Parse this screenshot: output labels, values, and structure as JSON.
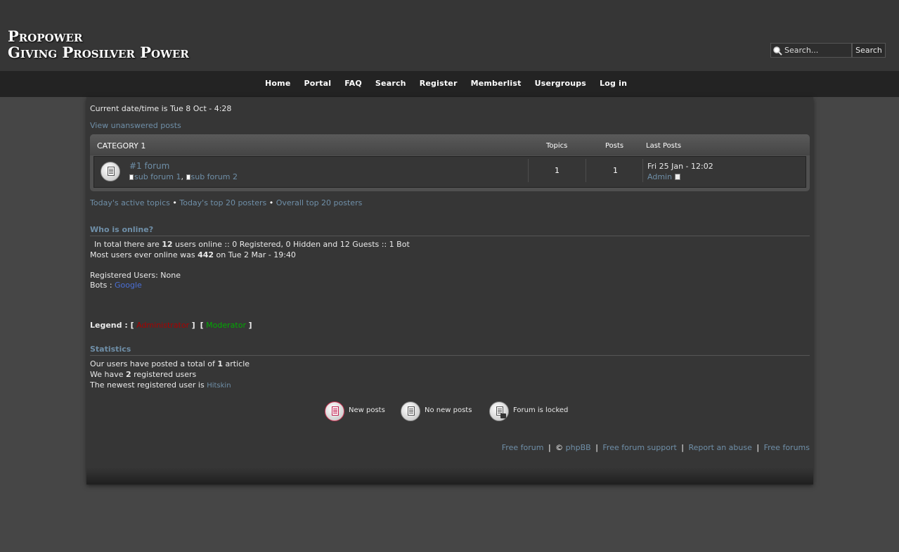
{
  "header": {
    "logo_line1": "Propower",
    "logo_line2": "Giving Prosilver Power",
    "search": {
      "placeholder": "Search...",
      "button": "Search"
    }
  },
  "nav": [
    "Home",
    "Portal",
    "FAQ",
    "Search",
    "Register",
    "Memberlist",
    "Usergroups",
    "Log in"
  ],
  "page": {
    "current_datetime": "Current date/time is Tue 8 Oct - 4:28",
    "unanswered_link": "View unanswered posts"
  },
  "category": {
    "title": "CATEGORY 1",
    "columns": {
      "topics": "Topics",
      "posts": "Posts",
      "last_posts": "Last Posts"
    },
    "forum": {
      "name": "#1 forum",
      "subforums": [
        "sub forum 1",
        "sub forum 2"
      ],
      "subforum_separator": ",",
      "topics": "1",
      "posts": "1",
      "last_post_date": "Fri 25 Jan - 12:02",
      "last_post_author": "Admin"
    }
  },
  "quick_links": {
    "active_topics": "Today's active topics",
    "top_today": "Today's top 20 posters",
    "top_overall": "Overall top 20 posters",
    "bullet": "•"
  },
  "who_online": {
    "title": "Who is online?",
    "line1_prefix": "In total there are ",
    "online_count": "12",
    "line1_suffix": " users online :: 0 Registered, 0 Hidden and 12 Guests :: 1 Bot",
    "line2_prefix": "Most users ever online was ",
    "record_count": "442",
    "line2_suffix": " on Tue 2 Mar - 19:40",
    "registered_users": "Registered Users: None",
    "bots_label": "Bots : ",
    "bot_name": "Google",
    "legend_label": "Legend : ",
    "legend_admin": "Administrator",
    "legend_mod": "Moderator",
    "admin_color": "#aa0000",
    "mod_color": "#00aa00"
  },
  "statistics": {
    "title": "Statistics",
    "line1_prefix": "Our users have posted a total of ",
    "articles": "1",
    "line1_suffix": " article",
    "line2_prefix": "We have ",
    "users": "2",
    "line2_suffix": " registered users",
    "line3_prefix": "The newest registered user is ",
    "newest_user": "Hitskin"
  },
  "icon_legend": {
    "new_posts": "New posts",
    "no_new_posts": "No new posts",
    "locked": "Forum is locked"
  },
  "footer": {
    "free_forum": "Free forum",
    "copyright": "©",
    "phpbb": "phpBB",
    "support": "Free forum support",
    "abuse": "Report an abuse",
    "free_forums": "Free forums",
    "separator": "|"
  },
  "colors": {
    "link": "#6f8fa8",
    "background": "#464646",
    "panel": "#363636",
    "navbar": "#232323"
  }
}
